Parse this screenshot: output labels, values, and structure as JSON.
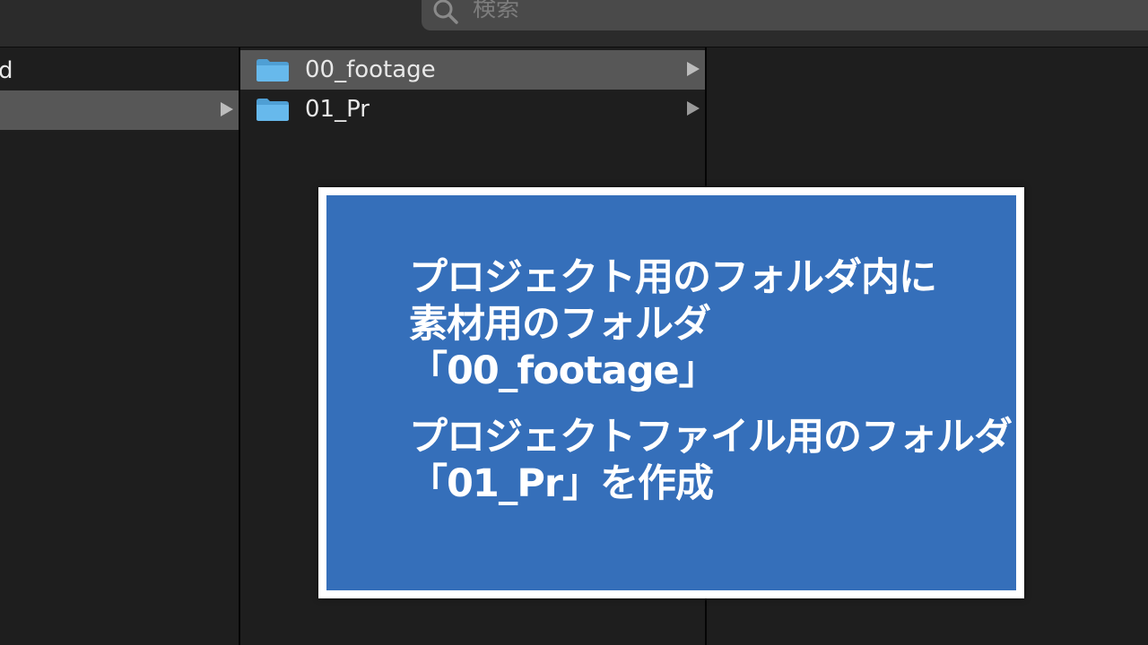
{
  "toolbar": {
    "search_placeholder": "検索"
  },
  "sidebar": {
    "items": [
      {
        "label": "d",
        "selected": false,
        "has_children": false
      },
      {
        "label": "",
        "selected": true,
        "has_children": true
      }
    ]
  },
  "browser": {
    "column2_items": [
      {
        "name": "00_footage",
        "selected": true,
        "has_children": true,
        "icon": "folder-icon"
      },
      {
        "name": "01_Pr",
        "selected": false,
        "has_children": true,
        "icon": "folder-icon"
      }
    ]
  },
  "callout": {
    "lines_top": [
      "プロジェクト用のフォルダ内に",
      "素材用のフォルダ",
      "「00_footage」"
    ],
    "lines_bottom": [
      "プロジェクトファイル用のフォルダ",
      "「01_Pr」を作成"
    ]
  },
  "colors": {
    "callout_background": "#356fba",
    "callout_border": "#ffffff",
    "selection": "#575757",
    "folder": "#5fb3e6"
  }
}
